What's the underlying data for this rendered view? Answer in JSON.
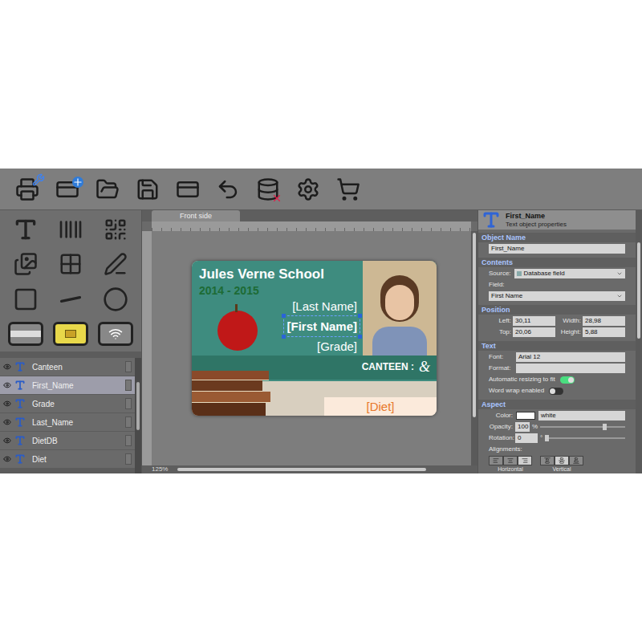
{
  "document_tabs": [
    {
      "label": "Front side",
      "selected": true
    }
  ],
  "layers": [
    {
      "name": "Canteen",
      "selected": false
    },
    {
      "name": "First_Name",
      "selected": true
    },
    {
      "name": "Grade",
      "selected": false
    },
    {
      "name": "Last_Name",
      "selected": false
    },
    {
      "name": "DietDB",
      "selected": false
    },
    {
      "name": "Diet",
      "selected": false
    }
  ],
  "canvas": {
    "zoom": "125%"
  },
  "card": {
    "title": "Jules Verne School",
    "year": "2014 - 2015",
    "fields": [
      {
        "text": "[Last Name]",
        "selected": false
      },
      {
        "text": "[First Name]",
        "selected": true
      },
      {
        "text": "[Grade]",
        "selected": false
      }
    ],
    "canteen_label": "CANTEEN :",
    "canteen_value": "&",
    "diet": "[Diet]"
  },
  "properties": {
    "title": "First_Name",
    "subtitle": "Text object properties",
    "object_name": {
      "heading": "Object Name",
      "value": "First_Name"
    },
    "contents": {
      "heading": "Contents",
      "source_label": "Source:",
      "source_value": "Database field",
      "field_label": "Field:",
      "field_value": "First Name"
    },
    "position": {
      "heading": "Position",
      "fields": [
        {
          "label": "Left:",
          "value": "30,11"
        },
        {
          "label": "Width:",
          "value": "28,98"
        },
        {
          "label": "Top:",
          "value": "20,06"
        },
        {
          "label": "Height:",
          "value": "5,88"
        }
      ]
    },
    "text": {
      "heading": "Text",
      "font_label": "Font:",
      "font_value": "Arial 12",
      "format_label": "Format:",
      "format_value": "",
      "toggles": [
        {
          "label": "Automatic resizing to fit",
          "on": true
        },
        {
          "label": "Word wrap enabled",
          "on": false
        }
      ]
    },
    "aspect": {
      "heading": "Aspect",
      "color_label": "Color:",
      "color_value": "white",
      "opacity_label": "Opacity:",
      "opacity_value": "100",
      "opacity_unit": "%",
      "opacity_level": 0.75,
      "rotation_label": "Rotation:",
      "rotation_value": "0",
      "rotation_unit": "°",
      "rotation_level": 0.02,
      "alignments_label": "Alignments:",
      "horizontal_label": "Horizontal",
      "vertical_label": "Vertical",
      "horizontal": [
        {
          "selected": false
        },
        {
          "selected": false
        },
        {
          "selected": true
        }
      ],
      "vertical": [
        {
          "selected": false
        },
        {
          "selected": true
        },
        {
          "selected": false
        }
      ]
    }
  }
}
